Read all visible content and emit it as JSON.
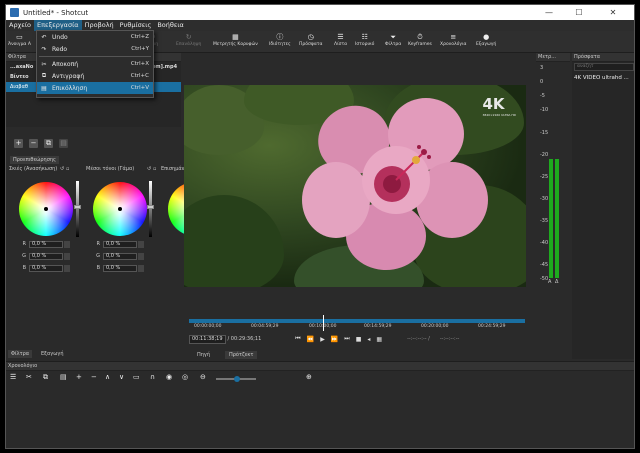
{
  "window": {
    "title": "Untitled* - Shotcut",
    "controls": [
      "—",
      "☐",
      "✕"
    ]
  },
  "menubar": {
    "items": [
      "Αρχείο",
      "Επεξεργασία",
      "Προβολή",
      "Ρυθμίσεις",
      "Βοήθεια"
    ],
    "active_index": 1
  },
  "toolbar": {
    "left_labels": [
      "Άνοιγμα Α",
      "Εξαγωγή"
    ],
    "buttons": [
      "Επανάληψη",
      "Μετρητής Κορυφών",
      "Ιδιότητες",
      "Πρόσφατα",
      "Λίστα",
      "Ιστορικό",
      "Φίλτρα",
      "Keyframes",
      "Χρονολόγια",
      "Εξαγωγή"
    ]
  },
  "edit_menu": {
    "items": [
      {
        "icon": "undo-icon",
        "glyph": "↶",
        "label": "Undo",
        "shortcut": "Ctrl+Z"
      },
      {
        "icon": "redo-icon",
        "glyph": "↷",
        "label": "Redo",
        "shortcut": "Ctrl+Y"
      },
      {
        "icon": "cut-icon",
        "glyph": "✂",
        "label": "Αποκοπή",
        "shortcut": "Ctrl+X"
      },
      {
        "icon": "copy-icon",
        "glyph": "⧉",
        "label": "Αντιγραφή",
        "shortcut": "Ctrl+C"
      },
      {
        "icon": "paste-icon",
        "glyph": "▤",
        "label": "Επικόλληση",
        "shortcut": "Ctrl+V"
      }
    ],
    "highlighted_index": 4
  },
  "filters_panel": {
    "header": "Φίλτρα",
    "clip_name": "com].mp4",
    "rows": [
      "...axaNo",
      "Βίντεο",
      "Διαβαθ"
    ],
    "selected_index": 2
  },
  "preview_tab": "Προεπιθεώρησης",
  "color_wheels": {
    "labels": [
      "Σκιές (Ανασήκωση)",
      "Μέσοι τόνοι (Γάμα)",
      "Επισημάν"
    ],
    "rgb": [
      {
        "r": "0,0 %",
        "g": "0,0 %",
        "b": "0,0 %"
      },
      {
        "r": "0,0 %",
        "g": "0,0 %",
        "b": "0,0 %"
      }
    ]
  },
  "left_bottom_tabs": [
    "Φίλτρα",
    "Εξαγωγή"
  ],
  "viewer": {
    "logo": "4K",
    "logo_sub": "3840×2160 ULTRA HD"
  },
  "scrubber": {
    "ticks": [
      "00:00:00;00",
      "00:04:59;29",
      "00:10:00;00",
      "00:14:59;29",
      "00:20:00;00",
      "00:24:59;29"
    ],
    "position_fraction": 0.4
  },
  "transport": {
    "current_time": "00:11:38;19",
    "total_time": "/ 00:29:36;11",
    "in_point": "--:--:--:-- /",
    "out_point": "--:--:--:--"
  },
  "viewer_tabs": [
    "Πηγή",
    "Πρότζεκτ"
  ],
  "meter": {
    "header": "Μετρ...",
    "scale": [
      "3",
      "0",
      "-5",
      "-10",
      "-15",
      "-20",
      "-25",
      "-30",
      "-35",
      "-40",
      "-45",
      "-50"
    ],
    "channel_labels": [
      "A",
      "Δ"
    ],
    "level_db": -20
  },
  "recent": {
    "header": "Πρόσφατα",
    "search_placeholder": "αναζητ",
    "items": [
      "4K VIDEO ultrahd ..."
    ]
  },
  "timeline": {
    "header": "Χρονολόγιο"
  }
}
